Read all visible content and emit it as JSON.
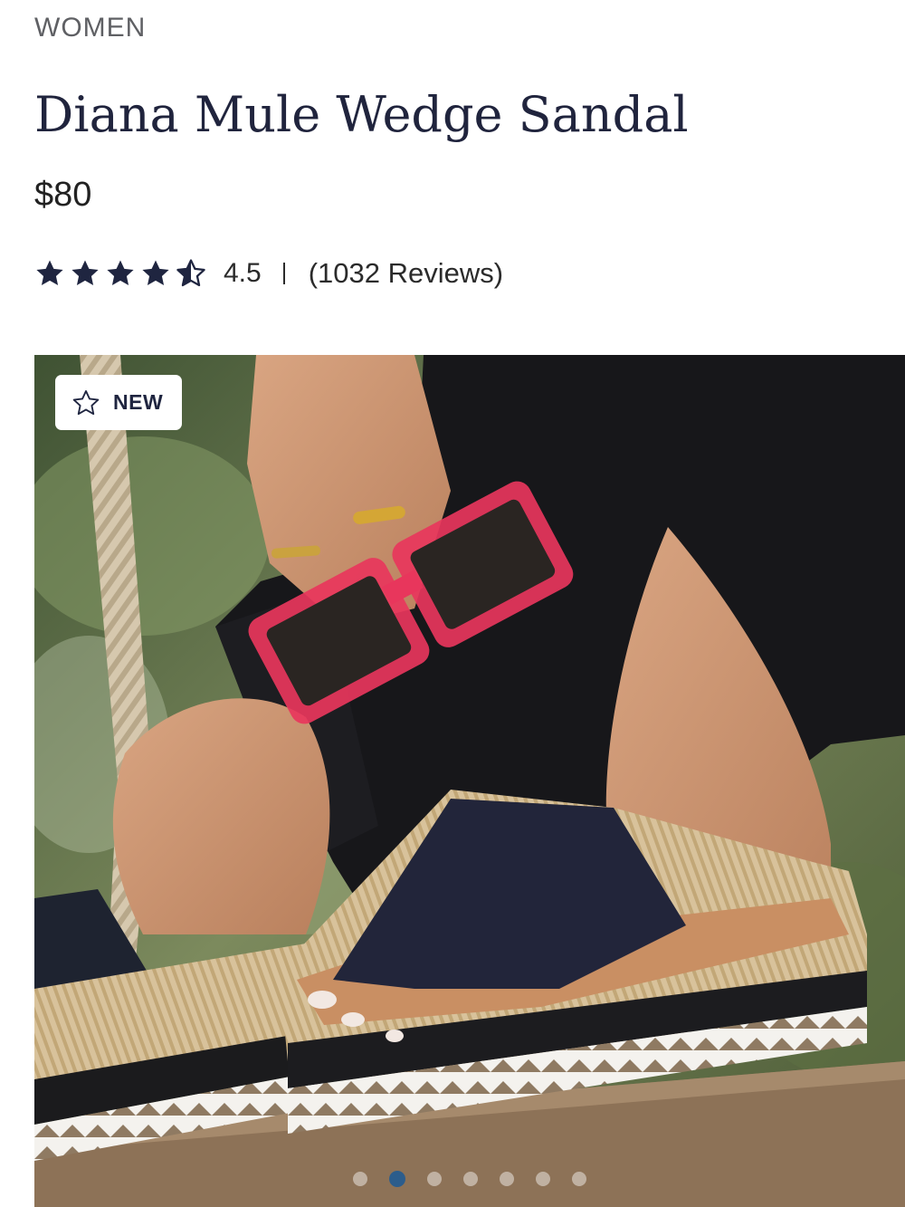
{
  "product": {
    "category": "WOMEN",
    "title": "Diana Mule Wedge Sandal",
    "price": "$80",
    "rating": {
      "value": "4.5",
      "stars": 4.5,
      "max_stars": 5,
      "reviews": "(1032 Reviews)"
    }
  },
  "gallery": {
    "badge_label": "NEW",
    "badge_icon": "star-outline-icon",
    "slide_count": 7,
    "active_slide": 2
  },
  "colors": {
    "text_primary": "#20243d",
    "star_fill": "#1f2540",
    "active_dot": "#2c5d8c"
  }
}
